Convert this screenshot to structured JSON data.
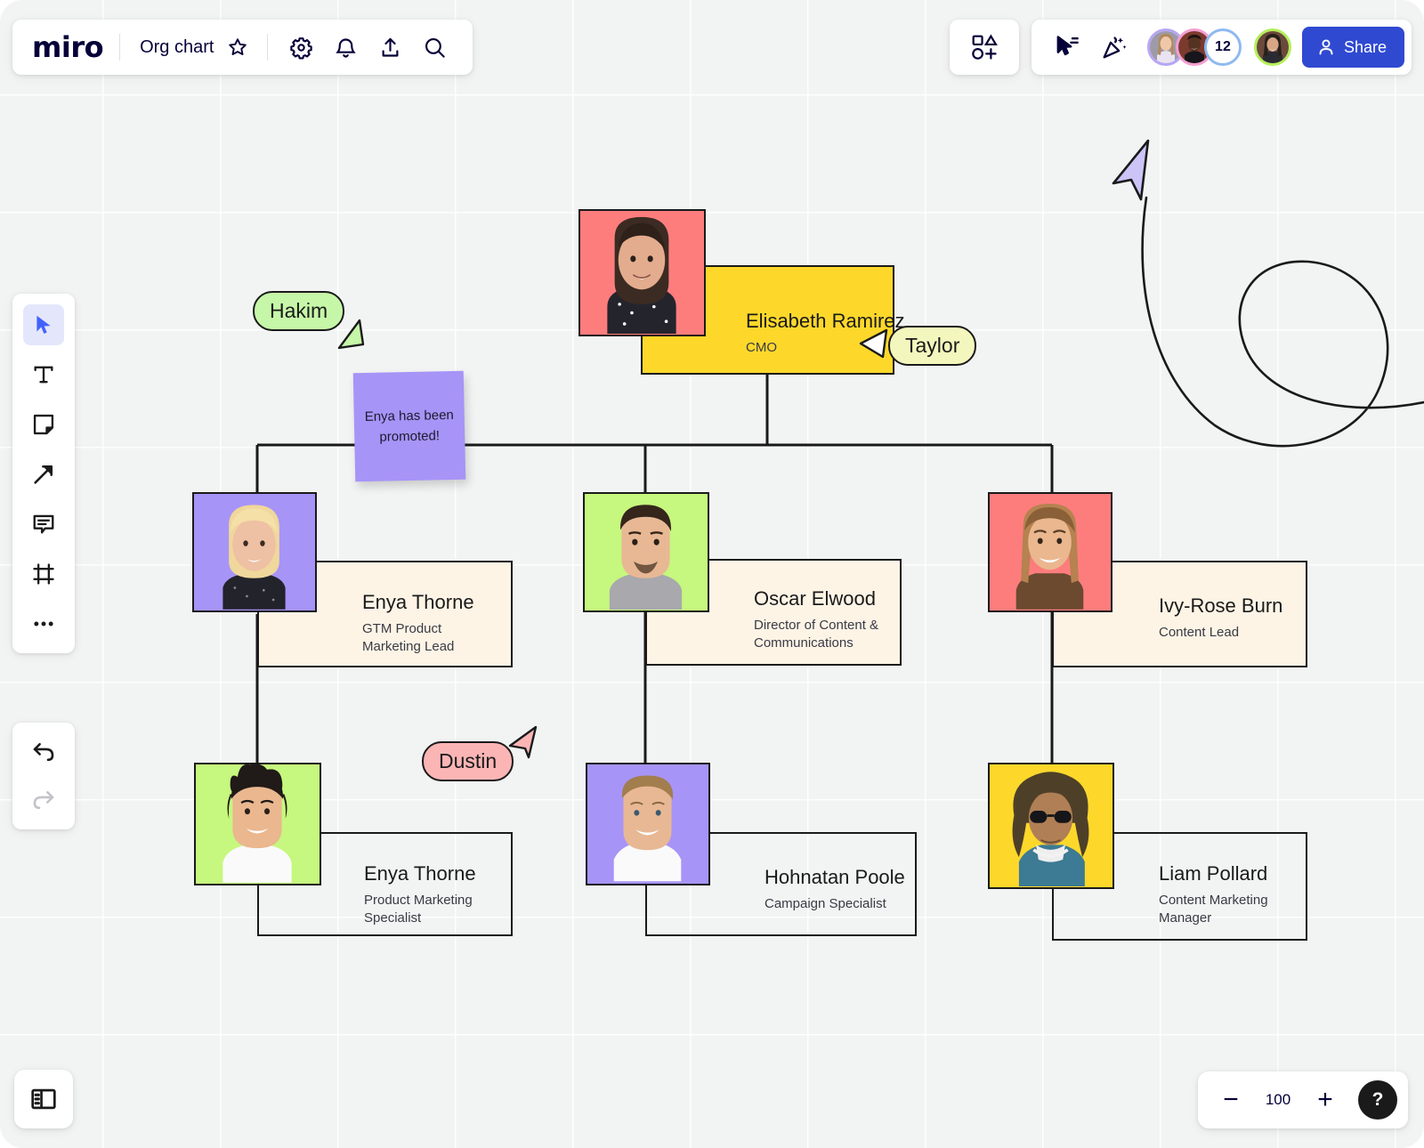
{
  "app": {
    "name": "miro",
    "board_title": "Org chart"
  },
  "header": {
    "logo_label": "miro",
    "star_icon": "star-icon",
    "settings_icon": "gear-icon",
    "notifications_icon": "bell-icon",
    "upload_icon": "upload-icon",
    "search_icon": "search-icon",
    "shapes_icon": "shapes-add-icon",
    "presentation_icon": "presentation-cursor-icon",
    "celebrate_icon": "party-popper-icon",
    "share_label": "Share",
    "share_icon": "person-icon",
    "share_color": "#2f49d1",
    "collaborator_count": "12",
    "avatar_ring_colors": [
      "#b7a6f5",
      "#f59ed0",
      "#8fb9f2",
      "#b5ef5a"
    ]
  },
  "left_toolbar": {
    "items": [
      {
        "name": "select-tool",
        "icon": "cursor-icon",
        "active": true
      },
      {
        "name": "text-tool",
        "icon": "text-icon",
        "active": false
      },
      {
        "name": "sticky-tool",
        "icon": "sticky-note-icon",
        "active": false
      },
      {
        "name": "shape-tool",
        "icon": "arrow-icon",
        "active": false
      },
      {
        "name": "comment-tool",
        "icon": "comment-icon",
        "active": false
      },
      {
        "name": "frame-tool",
        "icon": "frame-icon",
        "active": false
      },
      {
        "name": "more-tool",
        "icon": "more-dots-icon",
        "active": false
      }
    ],
    "undo_icon": "undo-icon",
    "redo_icon": "redo-icon",
    "panel_toggle_icon": "panel-toggle-icon"
  },
  "zoom_controls": {
    "minus_label": "−",
    "level": "100",
    "plus_label": "+",
    "help_label": "?"
  },
  "sticky_note": {
    "text": "Enya has been promoted!",
    "color": "#a794f7"
  },
  "cursors": [
    {
      "name": "Hakim",
      "label_bg": "#c6f7a8",
      "arrow_color": "#c6f7a8"
    },
    {
      "name": "Taylor",
      "label_bg": "#f4f7bd",
      "arrow_color": "#ffffff"
    },
    {
      "name": "Dustin",
      "label_bg": "#fcb5b5",
      "arrow_color": "#fcb5b5"
    },
    {
      "name": "",
      "label_bg": "",
      "arrow_color": "#ccc4f7"
    }
  ],
  "chart_data": {
    "type": "diagram",
    "title": "Org chart",
    "nodes": [
      {
        "id": "root",
        "name": "Elisabeth Ramirez",
        "role": "CMO",
        "card_color": "#fdd82b",
        "photo_bg": "#fd7d7d",
        "level": 0
      },
      {
        "id": "enya-lead",
        "name": "Enya Thorne",
        "role": "GTM Product Marketing Lead",
        "card_color": "#fdf4e6",
        "photo_bg": "#a794f7",
        "level": 1,
        "parent": "root"
      },
      {
        "id": "oscar",
        "name": "Oscar Elwood",
        "role": "Director of Content & Communications",
        "card_color": "#fdf4e6",
        "photo_bg": "#c6f77e",
        "level": 1,
        "parent": "root"
      },
      {
        "id": "ivy",
        "name": "Ivy-Rose Burn",
        "role": "Content Lead",
        "card_color": "#fdf4e6",
        "photo_bg": "#fd7d7d",
        "level": 1,
        "parent": "root"
      },
      {
        "id": "enya-spec",
        "name": "Enya Thorne",
        "role": "Product Marketing Specialist",
        "card_color": "transparent",
        "photo_bg": "#c6f77e",
        "level": 2,
        "parent": "enya-lead"
      },
      {
        "id": "hohnatan",
        "name": "Hohnatan Poole",
        "role": "Campaign Specialist",
        "card_color": "transparent",
        "photo_bg": "#a794f7",
        "level": 2,
        "parent": "oscar"
      },
      {
        "id": "liam",
        "name": "Liam Pollard",
        "role": "Content Marketing Manager",
        "card_color": "transparent",
        "photo_bg": "#fdd82b",
        "level": 2,
        "parent": "ivy"
      }
    ]
  }
}
